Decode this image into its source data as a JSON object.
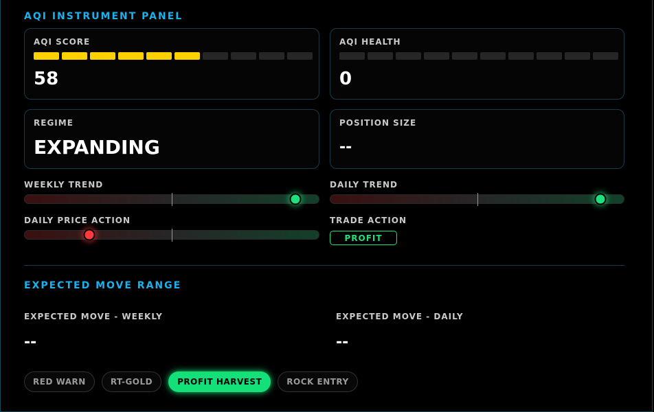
{
  "panel": {
    "title": "AQI INSTRUMENT PANEL"
  },
  "aqi_score": {
    "label": "AQI SCORE",
    "value": "58",
    "segments_on": 6,
    "segments_total": 10
  },
  "aqi_health": {
    "label": "AQI HEALTH",
    "value": "0",
    "segments_on": 0,
    "segments_total": 10
  },
  "regime": {
    "label": "REGIME",
    "value": "EXPANDING"
  },
  "position_size": {
    "label": "POSITION SIZE",
    "value": "--"
  },
  "weekly_trend": {
    "label": "WEEKLY TREND",
    "level": 0.92,
    "state": "green"
  },
  "daily_trend": {
    "label": "DAILY TREND",
    "level": 0.92,
    "state": "green"
  },
  "daily_price_action": {
    "label": "DAILY PRICE ACTION",
    "level": 0.22,
    "state": "red"
  },
  "trade_action": {
    "label": "TRADE ACTION",
    "value": "PROFIT"
  },
  "expected_move": {
    "title": "EXPECTED MOVE RANGE",
    "weekly_label": "EXPECTED MOVE - WEEKLY",
    "weekly_value": "--",
    "daily_label": "EXPECTED MOVE - DAILY",
    "daily_value": "--"
  },
  "modes": [
    {
      "label": "RED WARN",
      "active": false
    },
    {
      "label": "RT-GOLD",
      "active": false
    },
    {
      "label": "PROFIT HARVEST",
      "active": true
    },
    {
      "label": "ROCK ENTRY",
      "active": false
    }
  ],
  "colors": {
    "accent": "#1ab2ee",
    "score": "#ffd000",
    "positive": "#1fe07a",
    "negative": "#ff3a3a"
  }
}
